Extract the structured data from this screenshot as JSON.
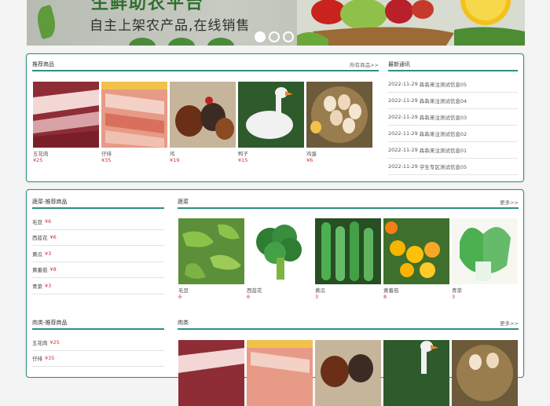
{
  "banner": {
    "title": "生鲜助农平台",
    "subtitle": "自主上架农产品,在线销售"
  },
  "featured": {
    "title": "推荐商品",
    "more": "所有商品>>",
    "products": [
      {
        "name": "五花肉",
        "price": "¥25"
      },
      {
        "name": "仔排",
        "price": "¥35"
      },
      {
        "name": "鸡",
        "price": "¥19"
      },
      {
        "name": "鸭子",
        "price": "¥15"
      },
      {
        "name": "鸡蛋",
        "price": "¥6"
      }
    ]
  },
  "news": {
    "title": "最新通讯",
    "items": [
      {
        "date": "2022-11-29",
        "text": "犇犇来注测试信息05"
      },
      {
        "date": "2022-11-29",
        "text": "犇犇来注测试信息04"
      },
      {
        "date": "2022-11-29",
        "text": "犇犇来注测试信息03"
      },
      {
        "date": "2022-11-29",
        "text": "犇犇来注测试信息02"
      },
      {
        "date": "2022-11-29",
        "text": "犇犇来注测试信息01"
      },
      {
        "date": "2022-11-29",
        "text": "学生专区测试信息05"
      }
    ]
  },
  "veg": {
    "rec_title": "蔬菜-推荐商品",
    "rec_items": [
      {
        "name": "毛豆",
        "price": "¥6"
      },
      {
        "name": "西蓝花",
        "price": "¥6"
      },
      {
        "name": "黄瓜",
        "price": "¥3"
      },
      {
        "name": "黄番茄",
        "price": "¥8"
      },
      {
        "name": "青菜",
        "price": "¥3"
      }
    ],
    "title": "蔬菜",
    "more": "更多>>",
    "products": [
      {
        "name": "毛豆",
        "price": "6"
      },
      {
        "name": "西蓝花",
        "price": "6"
      },
      {
        "name": "黄瓜",
        "price": "3"
      },
      {
        "name": "黄番茄",
        "price": "8"
      },
      {
        "name": "青菜",
        "price": "3"
      }
    ]
  },
  "meat": {
    "rec_title": "肉类-推荐商品",
    "rec_items": [
      {
        "name": "五花肉",
        "price": "¥25"
      },
      {
        "name": "仔排",
        "price": "¥35"
      }
    ],
    "title": "肉类",
    "more": "更多>>"
  }
}
